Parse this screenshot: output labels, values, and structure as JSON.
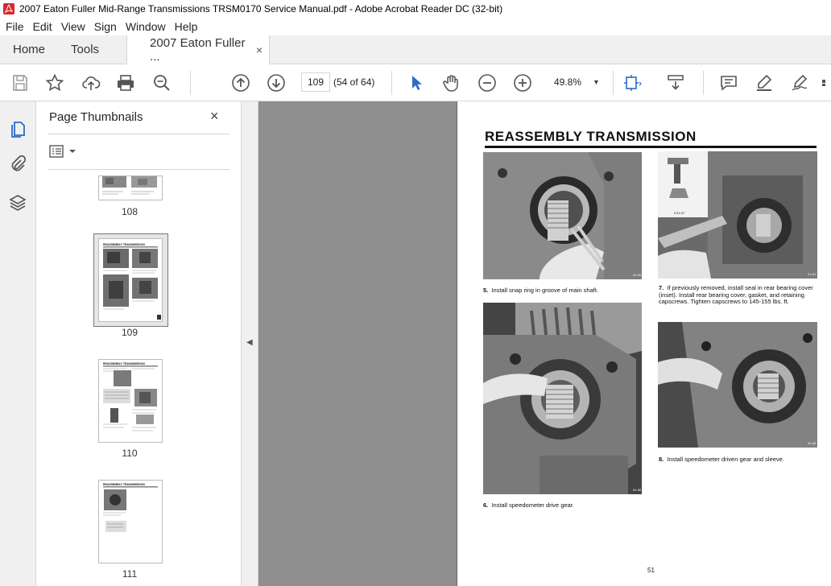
{
  "window": {
    "title": "2007 Eaton Fuller Mid-Range Transmissions TRSM0170 Service Manual.pdf - Adobe Acrobat Reader DC (32-bit)"
  },
  "menu": [
    "File",
    "Edit",
    "View",
    "Sign",
    "Window",
    "Help"
  ],
  "tabs": {
    "home": "Home",
    "tools": "Tools",
    "document": "2007 Eaton Fuller ...",
    "close": "×"
  },
  "toolbar": {
    "page_number": "109",
    "page_total": "(54 of 64)",
    "zoom": "49.8%"
  },
  "panel": {
    "title": "Page Thumbnails",
    "close": "×",
    "thumbnails": [
      {
        "label": "108"
      },
      {
        "label": "109",
        "selected": true
      },
      {
        "label": "110"
      },
      {
        "label": "111"
      }
    ],
    "thumb_headings": {
      "t109": "REASSEMBLY TRANSMISSION",
      "t110": "REASSEMBLY TRANSMISSION",
      "t111": "REASSEMBLY TRANSMISSION"
    }
  },
  "document": {
    "heading": "REASSEMBLY TRANSMISSION",
    "captions": {
      "c5_num": "5.",
      "c5": "Install snap ring in groove of main shaft.",
      "c6_num": "6.",
      "c6": "Install speedometer drive gear.",
      "c7_num": "7.",
      "c7": "If previously removed, install seal in rear bearing cover (inset). Install rear bearing cover, gasket, and retaining capscrews. Tighten capscrews to 145-155 lbs. ft.",
      "c8_num": "8.",
      "c8": "Install speedometer driven gear and sleeve."
    },
    "photo_ids": {
      "p5": "54-85",
      "p7": "54-81",
      "p6": "54-86",
      "p8": "54-88",
      "inset": "ES4-87"
    },
    "page_number": "51"
  },
  "colors": {
    "acrobat_red": "#d7282f",
    "icon_gray": "#555555",
    "select_blue": "#2d6ac8",
    "viewer_bg": "#8f8f8f"
  }
}
